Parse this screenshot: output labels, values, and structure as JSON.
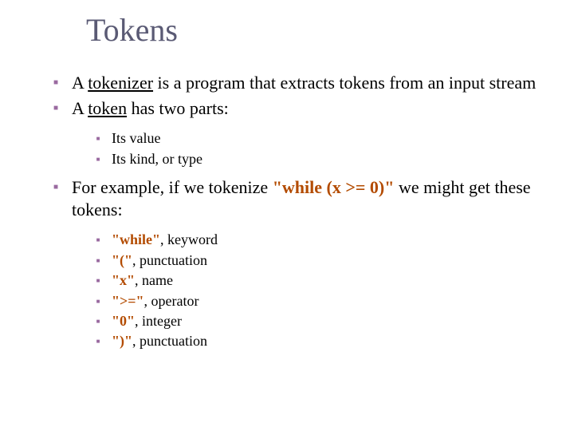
{
  "title": "Tokens",
  "bullets": {
    "b1_pre": "A ",
    "b1_u": "tokenizer",
    "b1_post": " is a program that extracts tokens from an input stream",
    "b2_pre": "A ",
    "b2_u": "token",
    "b2_post": " has two parts:",
    "b3_pre": "For example, if we tokenize ",
    "b3_code": "\"while (x >= 0)\"",
    "b3_post": " we might get these tokens:"
  },
  "sub1": {
    "a": "Its value",
    "b": "Its kind, or type"
  },
  "sub2": {
    "a_code": "\"while\"",
    "a_rest": ", keyword",
    "b_code": "\"(\"",
    "b_rest": ", punctuation",
    "c_code": "\"x\"",
    "c_rest": ", name",
    "d_code": "\">=\"",
    "d_rest": ", operator",
    "e_code": "\"0\"",
    "e_rest": ", integer",
    "f_code": "\")\"",
    "f_rest": ", punctuation"
  }
}
